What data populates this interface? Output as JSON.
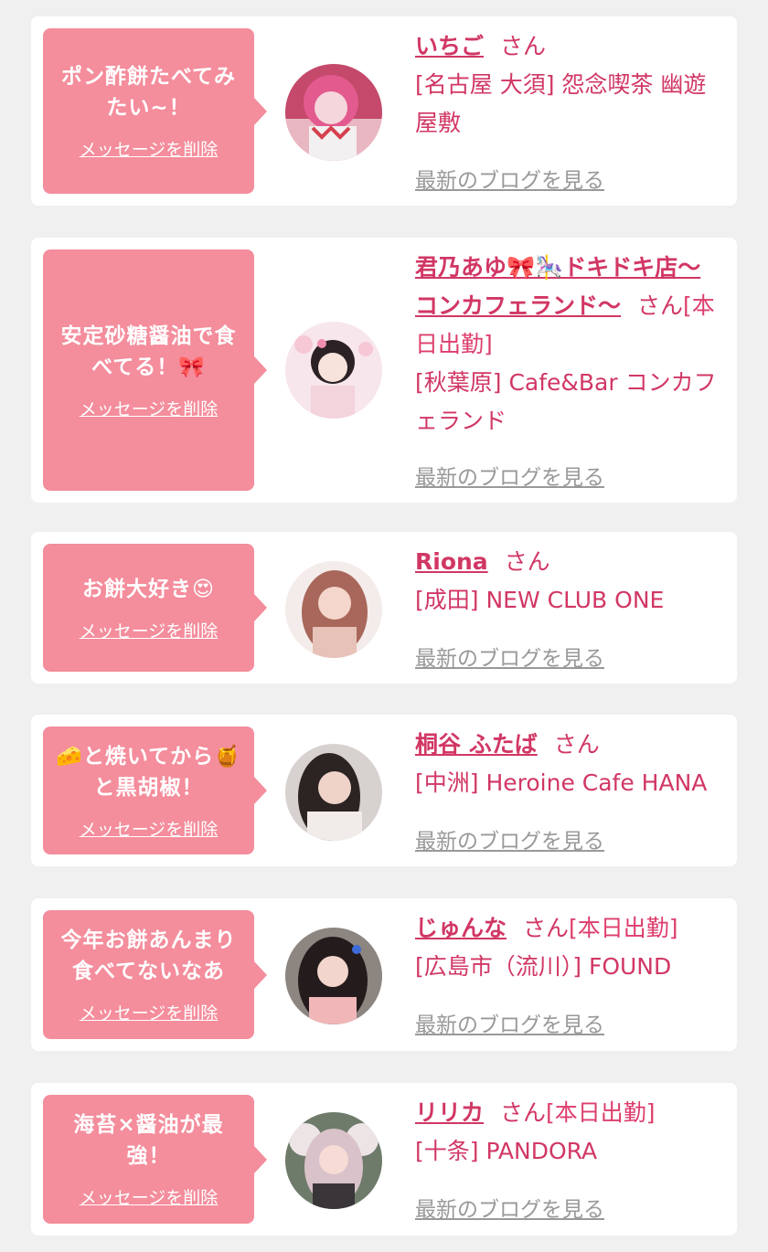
{
  "delete_label": "メッセージを削除",
  "blog_label": "最新のブログを見る",
  "honorific": "さん",
  "colors": {
    "accent": "#d13764",
    "bubble": "#f48d9c",
    "background": "#f0f0f1",
    "muted": "#999999"
  },
  "entries": [
    {
      "message": "ポン酢餅たべてみたい~！",
      "name": "いちご",
      "extra": "",
      "shop": "[名古屋 大須] 怨念喫茶 幽遊屋敷"
    },
    {
      "message": "安定砂糖醤油で食べてる！🎀",
      "name": "君乃あゆ🎀🎠ドキドキ店〜コンカフェランド〜",
      "extra": "[本日出勤]",
      "shop": "[秋葉原] Cafe&Bar コンカフェランド"
    },
    {
      "message": "お餅大好き😍",
      "name": "Riona",
      "extra": "",
      "shop": "[成田] NEW CLUB ONE"
    },
    {
      "message": "🧀と焼いてから🍯と黒胡椒！",
      "name": "桐谷 ふたば",
      "extra": "",
      "shop": "[中洲] Heroine Cafe HANA"
    },
    {
      "message": "今年お餅あんまり食べてないなあ",
      "name": "じゅんな",
      "extra": "[本日出勤]",
      "shop": "[広島市（流川）] FOUND"
    },
    {
      "message": "海苔×醤油が最強！",
      "name": "リリカ",
      "extra": "[本日出勤]",
      "shop": "[十条] PANDORA"
    }
  ]
}
